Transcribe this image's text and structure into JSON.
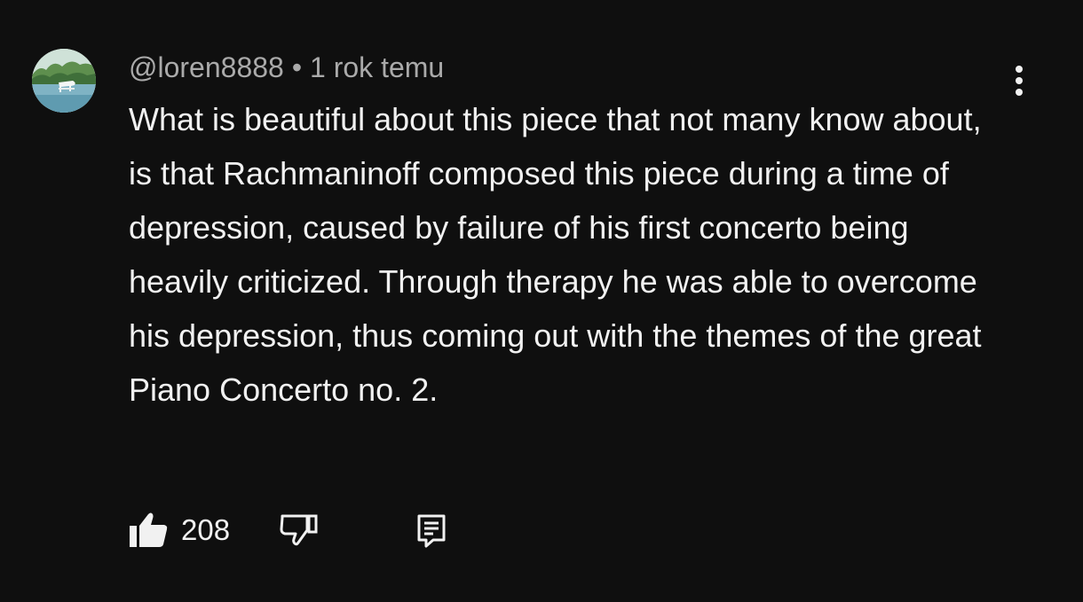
{
  "comment": {
    "author": "@loren8888",
    "separator": "•",
    "timestamp": "1 rok temu",
    "text": "What is beautiful about this piece that not many know about, is that Rachmaninoff composed this piece during a time of depression, caused by failure of his first concerto being heavily criticized. Through therapy he was able to overcome his depression, thus coming out with the themes of the great Piano Concerto no. 2.",
    "likes": "208"
  },
  "icons": {
    "avatar": "piano-by-lake-avatar",
    "more": "more-vertical-icon",
    "like": "thumb-up-icon",
    "dislike": "thumb-down-icon",
    "reply": "reply-comment-icon"
  },
  "colors": {
    "background": "#0f0f0f",
    "text_primary": "#f1f1f1",
    "text_secondary": "#aaaaaa"
  }
}
